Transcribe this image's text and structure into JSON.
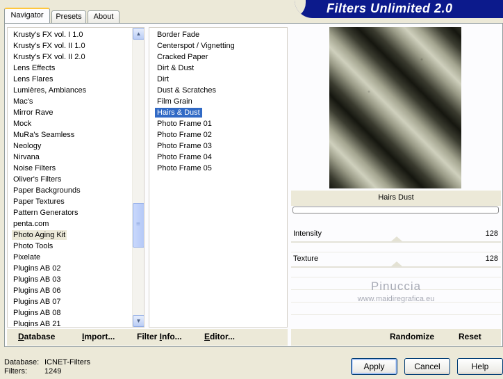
{
  "window": {
    "banner_title": "Filters Unlimited 2.0"
  },
  "tabs": [
    {
      "label": "Navigator",
      "active": true
    },
    {
      "label": "Presets",
      "active": false
    },
    {
      "label": "About",
      "active": false
    }
  ],
  "categories": {
    "selected": "Photo Aging Kit",
    "items": [
      "Krusty's FX vol. I 1.0",
      "Krusty's FX vol. II 1.0",
      "Krusty's FX vol. II 2.0",
      "Lens Effects",
      "Lens Flares",
      "Lumières, Ambiances",
      "Mac's",
      "Mirror Rave",
      "Mock",
      "MuRa's Seamless",
      "Neology",
      "Nirvana",
      "Noise Filters",
      "Oliver's Filters",
      "Paper Backgrounds",
      "Paper Textures",
      "Pattern Generators",
      "penta.com",
      "Photo Aging Kit",
      "Photo Tools",
      "Pixelate",
      "Plugins AB 02",
      "Plugins AB 03",
      "Plugins AB 06",
      "Plugins AB 07",
      "Plugins AB 08",
      "Plugins AB 21"
    ]
  },
  "filters": {
    "selected": "Hairs & Dust",
    "items": [
      "Border Fade",
      "Centerspot / Vignetting",
      "Cracked Paper",
      "Dirt & Dust",
      "Dirt",
      "Dust & Scratches",
      "Film Grain",
      "Hairs & Dust",
      "Photo Frame 01",
      "Photo Frame 02",
      "Photo Frame 03",
      "Photo Frame 04",
      "Photo Frame 05"
    ]
  },
  "preview": {
    "filter_name": "Hairs  Dust",
    "progress": 0
  },
  "sliders": [
    {
      "label": "Intensity",
      "value": "128",
      "level": 128,
      "max": 255
    },
    {
      "label": "Texture",
      "value": "128",
      "level": 128,
      "max": 255
    }
  ],
  "watermark": {
    "name": "Pinuccia",
    "url": "www.maidiregrafica.eu"
  },
  "toolbar": {
    "database": {
      "pre": "",
      "key": "D",
      "post": "atabase"
    },
    "import": {
      "pre": "",
      "key": "I",
      "post": "mport..."
    },
    "filter_info": {
      "pre": "Filter ",
      "key": "I",
      "post": "nfo..."
    },
    "editor": {
      "pre": "",
      "key": "E",
      "post": "ditor..."
    },
    "randomize": "Randomize",
    "reset": "Reset"
  },
  "info": {
    "database_label": "Database:",
    "database_value": "ICNET-Filters",
    "filters_label": "Filters:",
    "filters_value": "1249"
  },
  "buttons": {
    "apply": "Apply",
    "cancel": "Cancel",
    "help": "Help"
  }
}
